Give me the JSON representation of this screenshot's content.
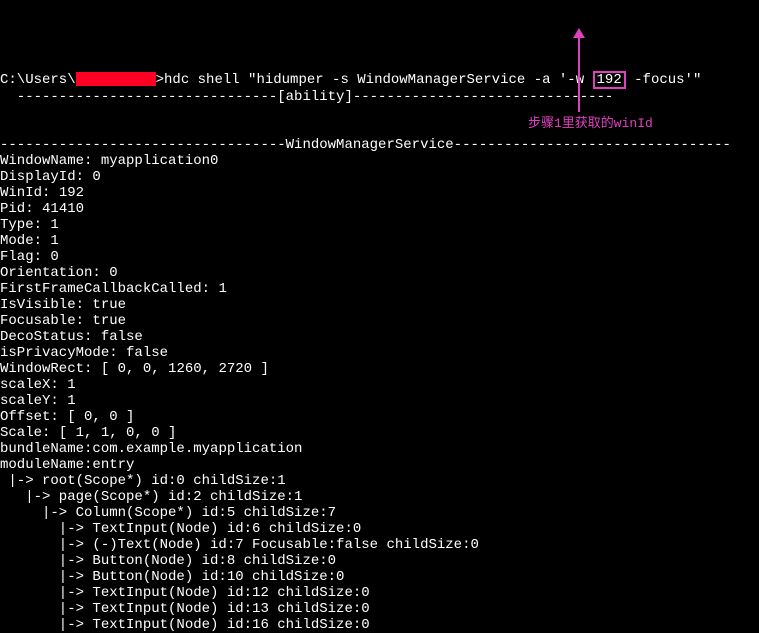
{
  "prompt_prefix": "C:\\Users\\",
  "prompt_suffix": ">",
  "cmd_before": "hdc shell \"hidumper -s WindowManagerService -a '-w ",
  "cmd_hl": "192",
  "cmd_after": " -focus'\"",
  "divider_ability": "  -------------------------------[ability]-------------------------------\n\n",
  "divider_service": "----------------------------------WindowManagerService---------------------------------",
  "props": {
    "WindowName": "myapplication0",
    "DisplayId": "0",
    "WinId": "192",
    "Pid": "41410",
    "Type": "1",
    "Mode": "1",
    "Flag": "0",
    "Orientation": "0",
    "FirstFrameCallbackCalled": "1",
    "IsVisible": "true",
    "Focusable": "true",
    "DecoStatus": "false",
    "isPrivacyMode": "false",
    "WindowRect": "[ 0, 0, 1260, 2720 ]",
    "scaleX": "1",
    "scaleY": "1",
    "Offset": "[ 0, 0 ]",
    "Scale": "[ 1, 1, 0, 0 ]",
    "bundleName": "com.example.myapplication",
    "moduleName": "entry"
  },
  "tree": [
    " |-> root(Scope*) id:0 childSize:1",
    "   |-> page(Scope*) id:2 childSize:1",
    "     |-> Column(Scope*) id:5 childSize:7",
    "       |-> TextInput(Node) id:6 childSize:0",
    "       |-> (-)Text(Node) id:7 Focusable:false childSize:0",
    "       |-> Button(Node) id:8 childSize:0",
    "       |-> Button(Node) id:10 childSize:0",
    "       |-> TextInput(Node) id:12 childSize:0",
    "       |-> TextInput(Node) id:13 childSize:0",
    "       |-> TextInput(Node) id:16 childSize:0"
  ],
  "annotation": "步骤1里获取的winId"
}
